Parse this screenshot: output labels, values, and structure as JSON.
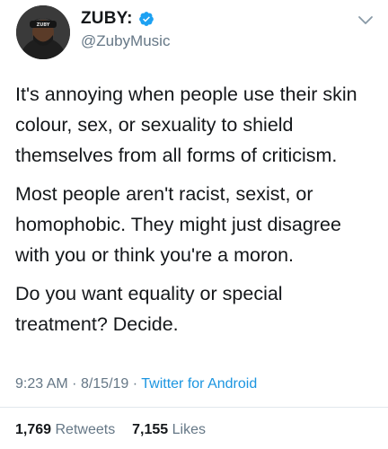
{
  "author": {
    "display_name": "ZUBY:",
    "handle": "@ZubyMusic",
    "verified": true,
    "avatar_icon": "profile-photo"
  },
  "tweet": {
    "paragraphs": [
      "It's annoying when people use their skin colour, sex, or sexuality to shield themselves from all forms of criticism.",
      "Most people aren't racist, sexist, or homophobic. They might just disagree with you or think you're a moron.",
      "Do you want equality or special treatment? Decide."
    ],
    "time": "9:23 AM",
    "date": "8/15/19",
    "separator": "·",
    "source": "Twitter for Android"
  },
  "stats": {
    "retweets_count": "1,769",
    "retweets_label": "Retweets",
    "likes_count": "7,155",
    "likes_label": "Likes"
  },
  "colors": {
    "text": "#14171a",
    "muted": "#657786",
    "link": "#1b95e0",
    "verified": "#1da1f2",
    "divider": "#e1e8ed"
  }
}
